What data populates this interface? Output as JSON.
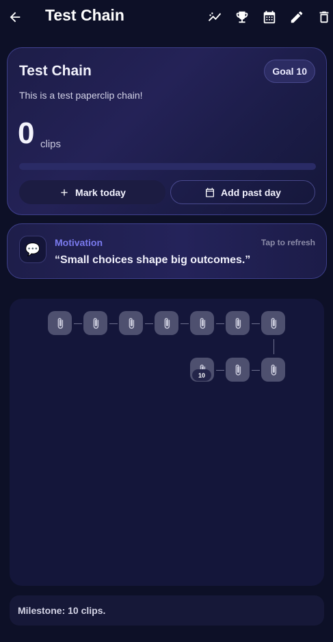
{
  "appbar": {
    "title": "Test Chain",
    "icons": [
      "back-arrow-icon",
      "trend-chart-icon",
      "trophy-icon",
      "calendar-icon",
      "edit-pencil-icon",
      "delete-icon"
    ]
  },
  "chain": {
    "title": "Test Chain",
    "goal_badge": "Goal 10",
    "description": "This is a test paperclip chain!",
    "count": "0",
    "count_unit": "clips",
    "progress": 0,
    "mark_today_label": "Mark today",
    "add_past_day_label": "Add past day"
  },
  "motivation": {
    "label": "Motivation",
    "refresh_hint": "Tap to refresh",
    "quote": "“Small choices shape big outcomes.”",
    "icon": "chat-bubble-icon"
  },
  "clips": {
    "total": 10,
    "milestone_label": "10"
  },
  "milestone": {
    "text": "Milestone: 10 clips."
  },
  "colors": {
    "background": "#0d1027",
    "accent": "#6366f1",
    "clip": "#4e506f"
  }
}
